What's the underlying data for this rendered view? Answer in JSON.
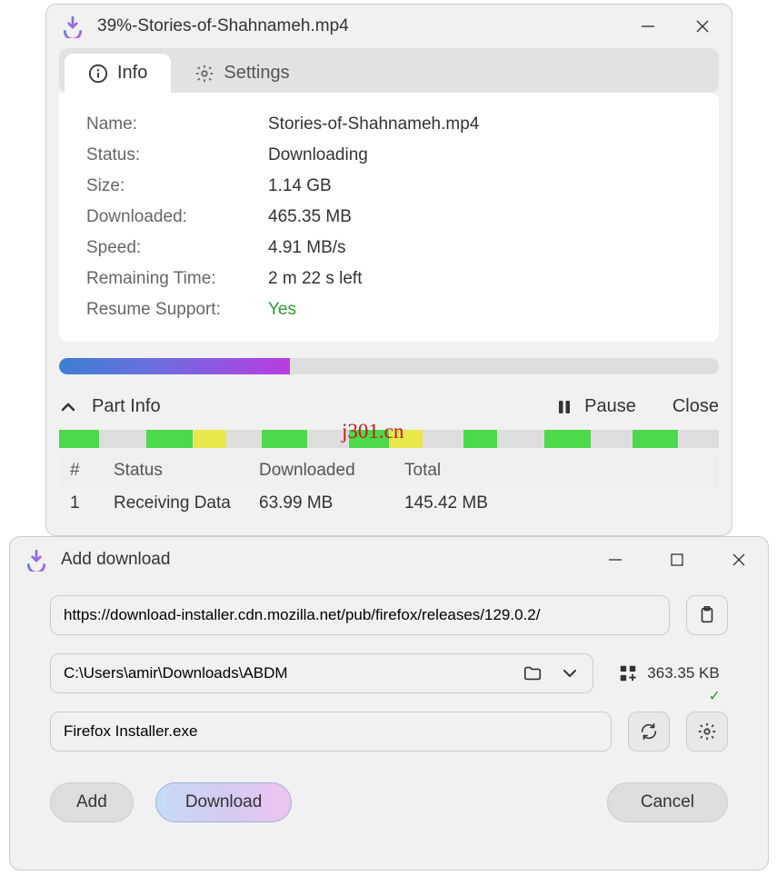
{
  "window1": {
    "title": "39%-Stories-of-Shahnameh.mp4",
    "tabs": {
      "info": "Info",
      "settings": "Settings"
    },
    "info": {
      "name_label": "Name:",
      "name_value": "Stories-of-Shahnameh.mp4",
      "status_label": "Status:",
      "status_value": "Downloading",
      "size_label": "Size:",
      "size_value": "1.14 GB",
      "downloaded_label": "Downloaded:",
      "downloaded_value": "465.35 MB",
      "speed_label": "Speed:",
      "speed_value": "4.91 MB/s",
      "remaining_label": "Remaining Time:",
      "remaining_value": "2 m 22 s left",
      "resume_label": "Resume Support:",
      "resume_value": "Yes"
    },
    "progress_percent": 35,
    "partinfo_label": "Part Info",
    "pause_label": "Pause",
    "close_label": "Close",
    "parts_header": {
      "num": "#",
      "status": "Status",
      "downloaded": "Downloaded",
      "total": "Total"
    },
    "parts": [
      {
        "num": "1",
        "status": "Receiving Data",
        "downloaded": "63.99 MB",
        "total": "145.42 MB"
      }
    ]
  },
  "watermark": "j301.cn",
  "window2": {
    "title": "Add download",
    "url": "https://download-installer.cdn.mozilla.net/pub/firefox/releases/129.0.2/",
    "path": "C:\\Users\\amir\\Downloads\\ABDM",
    "filename": "Firefox Installer.exe",
    "size": "363.35 KB",
    "add_label": "Add",
    "download_label": "Download",
    "cancel_label": "Cancel"
  }
}
